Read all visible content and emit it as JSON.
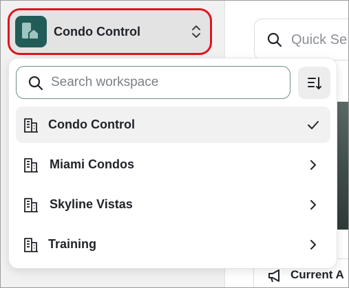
{
  "workspace_switcher": {
    "current": "Condo Control",
    "highlight_color": "#e0141e",
    "logo_color": "#225c58",
    "toggle_icon": "chevron-up-down-icon"
  },
  "dropdown": {
    "search": {
      "placeholder": "Search workspace",
      "value": ""
    },
    "sort_icon": "sort-icon",
    "items": [
      {
        "label": "Condo Control",
        "icon": "building-icon",
        "selected": true,
        "trailing_icon": "check-icon"
      },
      {
        "label": "Miami Condos",
        "icon": "building-icon",
        "selected": false,
        "trailing_icon": "chevron-right-icon"
      },
      {
        "label": "Skyline Vistas",
        "icon": "building-icon",
        "selected": false,
        "trailing_icon": "chevron-right-icon"
      },
      {
        "label": "Training",
        "icon": "building-icon",
        "selected": false,
        "trailing_icon": "chevron-right-icon"
      }
    ]
  },
  "main": {
    "quick_search_placeholder": "Quick Se",
    "announcement_label": "Current A"
  }
}
